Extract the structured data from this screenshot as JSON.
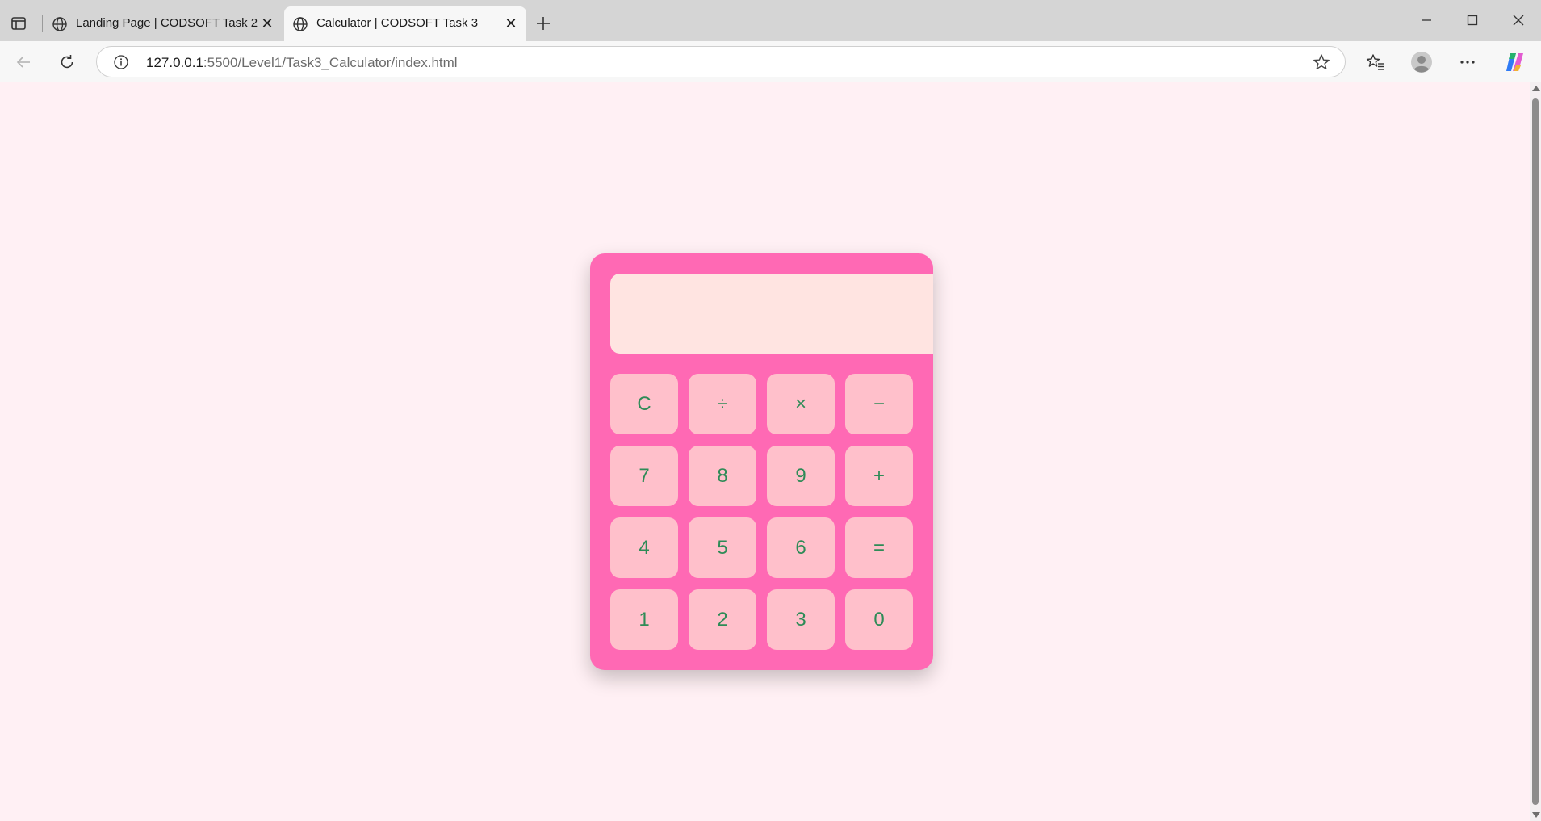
{
  "browser": {
    "tabs": [
      {
        "title": "Landing Page | CODSOFT Task 2",
        "active": false,
        "icon": "globe-icon"
      },
      {
        "title": "Calculator | CODSOFT Task 3",
        "active": true,
        "icon": "globe-icon"
      }
    ],
    "address": {
      "host": "127.0.0.1",
      "rest": ":5500/Level1/Task3_Calculator/index.html"
    }
  },
  "calculator": {
    "display_value": "",
    "keys": [
      "C",
      "÷",
      "×",
      "−",
      "7",
      "8",
      "9",
      "+",
      "4",
      "5",
      "6",
      "=",
      "1",
      "2",
      "3",
      "0"
    ]
  },
  "colors": {
    "page_background": "#fff0f4",
    "calculator_body": "#ff69b4",
    "display": "#ffe4e1",
    "key": "#ffc0cb",
    "key_text": "#2e8b57"
  }
}
